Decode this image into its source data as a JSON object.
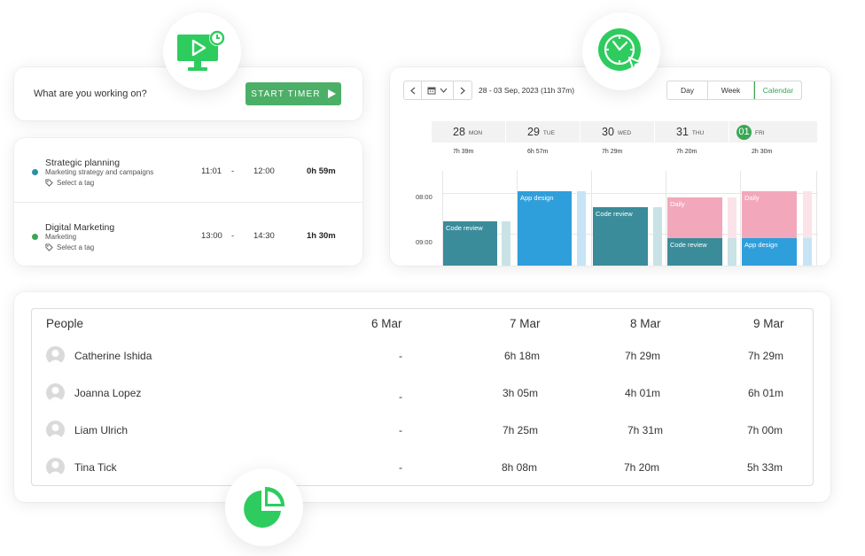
{
  "timer": {
    "prompt": "What are you working on?",
    "start_label": "START TIMER"
  },
  "entries": [
    {
      "title": "Strategic planning",
      "project": "Marketing strategy and campaigns",
      "tag": "Select a tag",
      "start": "11:01",
      "sep": "-",
      "end": "12:00",
      "duration": "0h 59m",
      "color": "#2e8fa3"
    },
    {
      "title": "Digital Marketing",
      "project": "Marketing",
      "tag": "Select a tag",
      "start": "13:00",
      "sep": "-",
      "end": "14:30",
      "duration": "1h 30m",
      "color": "#3aa755"
    }
  ],
  "calendar": {
    "range": "28 - 03 Sep, 2023 (11h 37m)",
    "views": [
      "Day",
      "Week",
      "Calendar"
    ],
    "active_view": "Calendar",
    "days": [
      {
        "num": "28",
        "name": "MON",
        "total": "7h 39m"
      },
      {
        "num": "29",
        "name": "TUE",
        "total": "6h 57m"
      },
      {
        "num": "30",
        "name": "WED",
        "total": "7h 29m"
      },
      {
        "num": "31",
        "name": "THU",
        "total": "7h 20m"
      },
      {
        "num": "01",
        "name": "FRI",
        "total": "2h 30m",
        "today": true
      }
    ],
    "hours": [
      "08:00",
      "09:00"
    ],
    "events": [
      {
        "day": 0,
        "label": "Code review",
        "color": "#3a8c9a"
      },
      {
        "day": 1,
        "label": "App design",
        "color": "#2f9fdc"
      },
      {
        "day": 2,
        "label": "Code review",
        "color": "#3a8c9a"
      },
      {
        "day": 3,
        "label": "Daily",
        "color": "#f2a8ba"
      },
      {
        "day": 3,
        "label": "Code review",
        "color": "#3a8c9a"
      },
      {
        "day": 4,
        "label": "Daily",
        "color": "#f2a8ba"
      },
      {
        "day": 4,
        "label": "App design",
        "color": "#2f9fdc"
      }
    ],
    "accent": "#3aa755"
  },
  "people": {
    "header": {
      "col0": "People",
      "dates": [
        "6 Mar",
        "7 Mar",
        "8 Mar",
        "9 Mar"
      ]
    },
    "rows": [
      {
        "name": "Catherine Ishida",
        "values": [
          "-",
          "6h 18m",
          "7h 29m",
          "7h 29m"
        ]
      },
      {
        "name": "Joanna Lopez",
        "values": [
          "-",
          "3h 05m",
          "4h 01m",
          "6h 01m"
        ]
      },
      {
        "name": "Liam Ulrich",
        "values": [
          "-",
          "7h 25m",
          "7h 31m",
          "7h 00m"
        ]
      },
      {
        "name": "Tina Tick",
        "values": [
          "-",
          "8h 08m",
          "7h 20m",
          "5h 33m"
        ]
      }
    ]
  },
  "badges": [
    "monitor-timer-icon",
    "clock-cursor-icon",
    "pie-chart-icon"
  ],
  "brand_green": "#3aa755"
}
